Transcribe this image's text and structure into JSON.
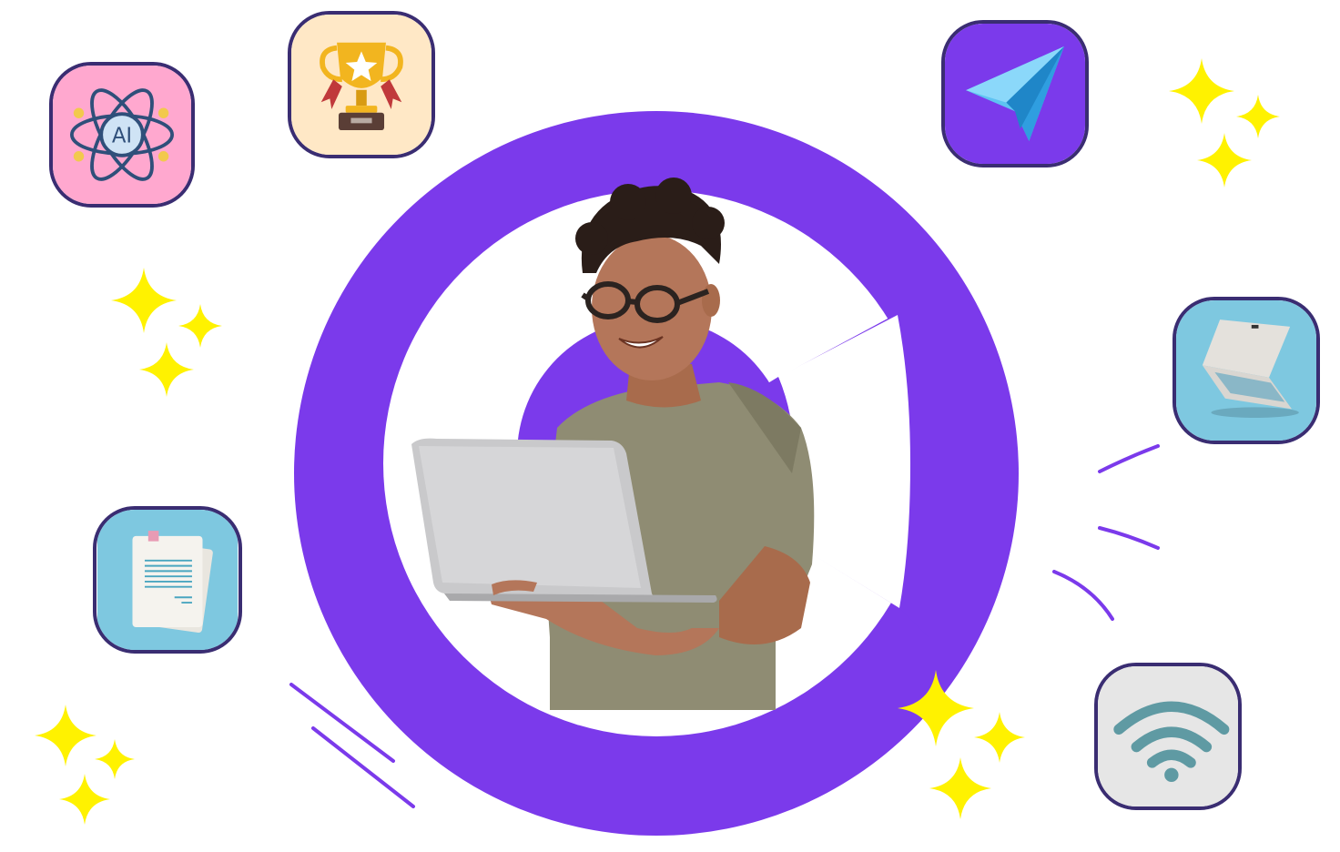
{
  "illustration": {
    "brand_color": "#7B3AEB",
    "sparkle_color": "#FFF200",
    "tile_border_color": "#3A2D72",
    "center": {
      "subject": "smiling-person-with-laptop"
    },
    "tiles": [
      {
        "icon": "ai-atom-icon",
        "label": "AI",
        "bg": "#FFA8CF"
      },
      {
        "icon": "trophy-icon",
        "bg": "#FFE8C6"
      },
      {
        "icon": "paper-plane-icon",
        "bg": "#7B3AEB"
      },
      {
        "icon": "laptop-icon",
        "bg": "#7EC8E0"
      },
      {
        "icon": "documents-icon",
        "bg": "#7EC8E0"
      },
      {
        "icon": "wifi-icon",
        "bg": "#E6E6E6"
      }
    ]
  }
}
